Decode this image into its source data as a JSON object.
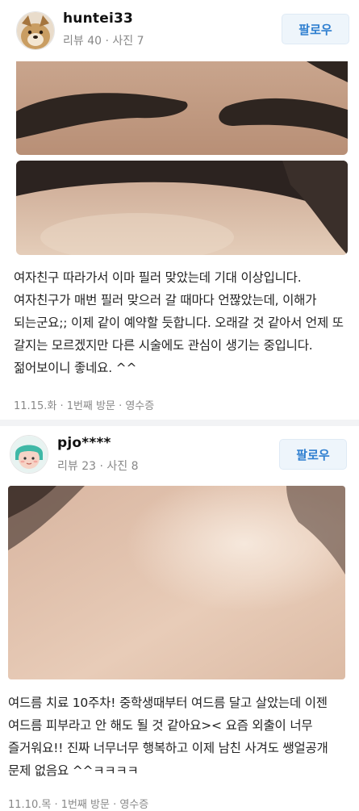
{
  "reviews": [
    {
      "username": "huntei33",
      "stats": "리뷰 40 · 사진 7",
      "follow_label": "팔로우",
      "text": "여자친구 따라가서 이마 필러 맞았는데 기대 이상입니다. 여자친구가 매번 필러 맞으러 갈 때마다 언짢았는데, 이해가 되는군요;; 이제 같이 예약할 듯합니다. 오래갈 것 같아서 언제 또 갈지는 모르겠지만 다른 시술에도 관심이 생기는 중입니다. 젊어보이니 좋네요. ^^",
      "footer": "11.15.화 · 1번째 방문 · 영수증"
    },
    {
      "username": "pjo****",
      "stats": "리뷰 23 · 사진 8",
      "follow_label": "팔로우",
      "text": "여드름 치료 10주차! 중학생때부터 여드름 달고 살았는데 이젠 여드름 피부라고 안 해도 될 것 같아요>< 요즘 외출이 너무 즐거워요!! 진짜 너무너무 행복하고 이제 남친 사겨도 쌩얼공개 문제 없음요 ^^ㅋㅋㅋㅋ",
      "footer": "11.10.목 · 1번째 방문 · 영수증"
    }
  ]
}
